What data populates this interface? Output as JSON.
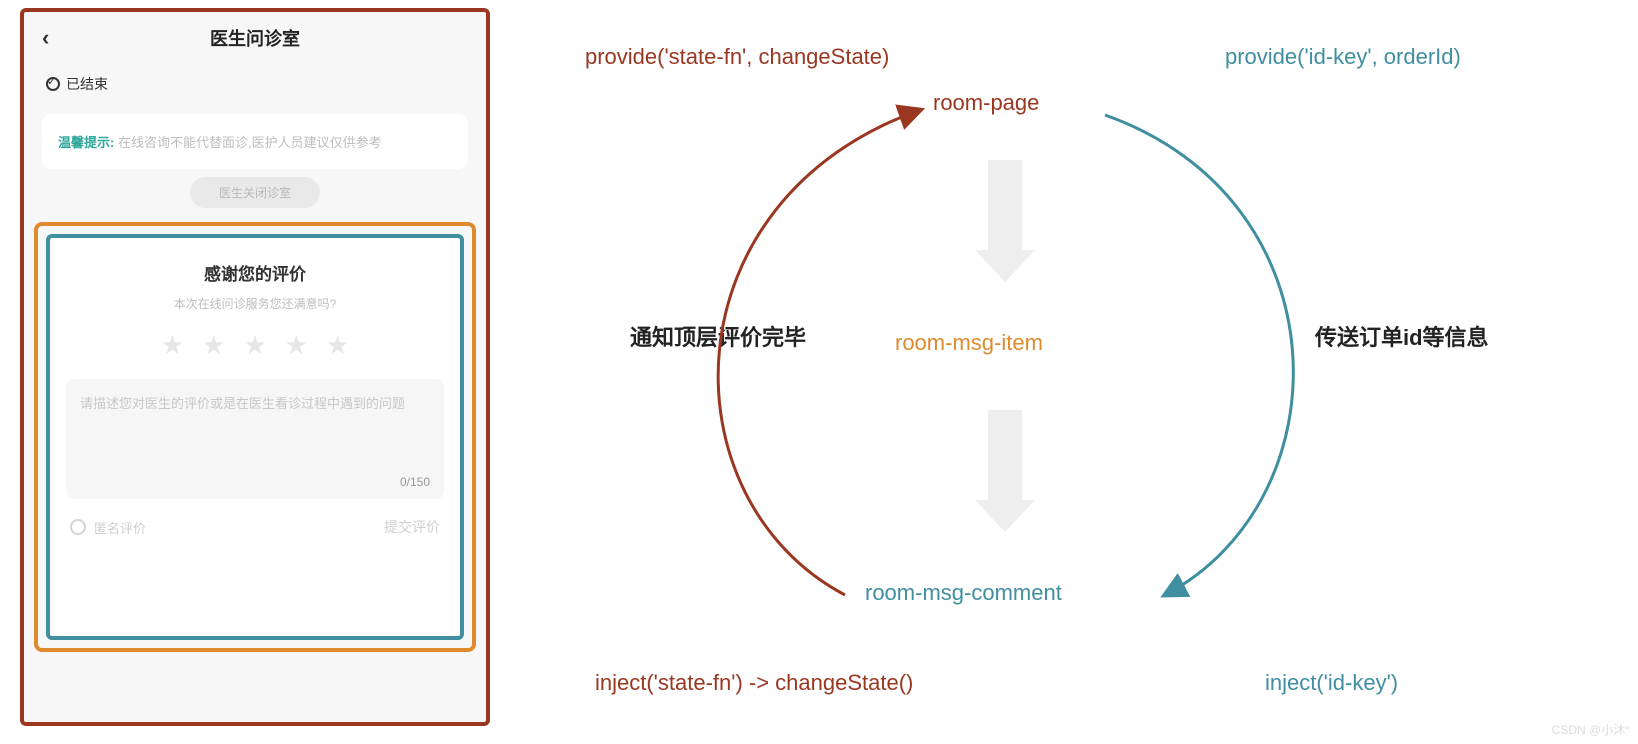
{
  "phone": {
    "title": "医生问诊室",
    "status": "已结束",
    "tip_label": "温馨提示:",
    "tip_text": "在线咨询不能代替面诊,医护人员建议仅供参考",
    "pill": "医生关闭诊室",
    "comment": {
      "title": "感谢您的评价",
      "subtitle": "本次在线问诊服务您还满意吗?",
      "placeholder": "请描述您对医生的评价或是在医生看诊过程中遇到的问题",
      "counter": "0/150",
      "anon": "匿名评价",
      "submit": "提交评价"
    }
  },
  "diagram": {
    "provide_left": "provide('state-fn', changeState)",
    "provide_right": "provide('id-key', orderId)",
    "room_page": "room-page",
    "room_msg_item": "room-msg-item",
    "room_msg_comment": "room-msg-comment",
    "left_mid": "通知顶层评价完毕",
    "right_mid": "传送订单id等信息",
    "inject_left": "inject('state-fn') -> changeState()",
    "inject_right": "inject('id-key')"
  },
  "watermark": "CSDN @小沐°"
}
